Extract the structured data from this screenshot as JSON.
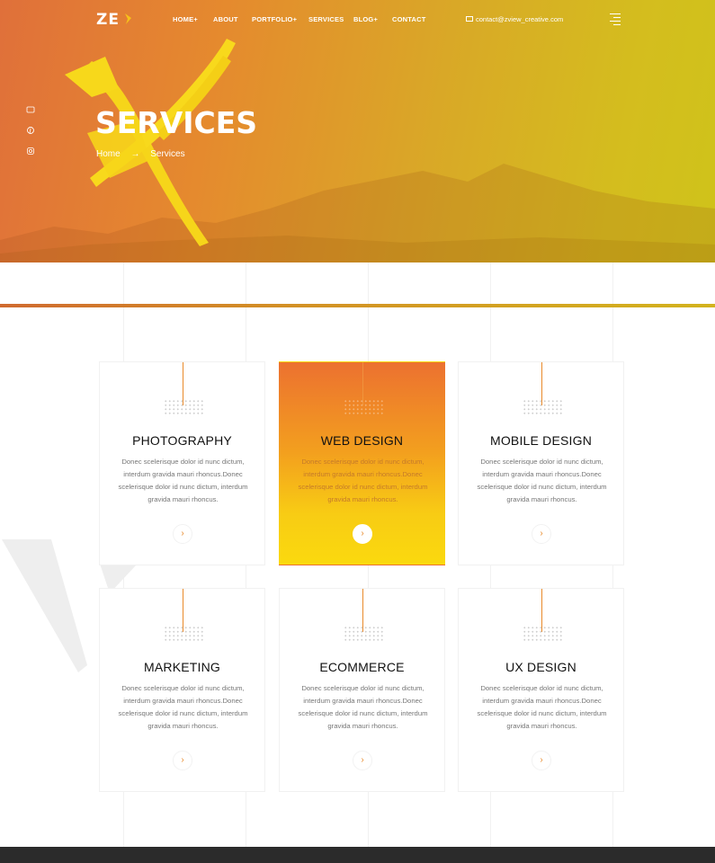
{
  "header": {
    "logo": "ZE",
    "nav": [
      {
        "label": "HOME",
        "plus": "+"
      },
      {
        "label": "ABOUT",
        "plus": ""
      },
      {
        "label": "PORTFOLIO",
        "plus": "+"
      },
      {
        "label": "SERVICES",
        "plus": ""
      },
      {
        "label": "BLOG",
        "plus": "+"
      },
      {
        "label": "CONTACT",
        "plus": ""
      }
    ],
    "email": "contact@zview_creative.com"
  },
  "hero": {
    "title": "SERVICES",
    "breadcrumb_home": "Home",
    "breadcrumb_arrow": "→",
    "breadcrumb_current": "Services"
  },
  "social_icons": [
    "facebook-icon",
    "pinterest-icon",
    "instagram-icon"
  ],
  "services": [
    {
      "title": "PHOTOGRAPHY",
      "desc": "Donec scelerisque dolor id nunc dictum, interdum gravida mauri rhoncus.Donec scelerisque dolor id nunc dictum, interdum gravida mauri rhoncus.",
      "button": "›",
      "active": false
    },
    {
      "title": "WEB DESIGN",
      "desc": "Donec scelerisque dolor id nunc dictum, interdum gravida mauri rhoncus.Donec scelerisque dolor id nunc dictum, interdum gravida mauri rhoncus.",
      "button": "›",
      "active": true
    },
    {
      "title": "MOBILE DESIGN",
      "desc": "Donec scelerisque dolor id nunc dictum, interdum gravida mauri rhoncus.Donec scelerisque dolor id nunc dictum, interdum gravida mauri rhoncus.",
      "button": "›",
      "active": false
    },
    {
      "title": "MARKETING",
      "desc": "Donec scelerisque dolor id nunc dictum, interdum gravida mauri rhoncus.Donec scelerisque dolor id nunc dictum, interdum gravida mauri rhoncus.",
      "button": "›",
      "active": false
    },
    {
      "title": "ECOMMERCE",
      "desc": "Donec scelerisque dolor id nunc dictum, interdum gravida mauri rhoncus.Donec scelerisque dolor id nunc dictum, interdum gravida mauri rhoncus.",
      "button": "›",
      "active": false
    },
    {
      "title": "UX DESIGN",
      "desc": "Donec scelerisque dolor id nunc dictum, interdum gravida mauri rhoncus.Donec scelerisque dolor id nunc dictum, interdum gravida mauri rhoncus.",
      "button": "›",
      "active": false
    }
  ],
  "colors": {
    "accent_orange": "#ec7130",
    "accent_yellow": "#fad90e",
    "hero_left": "#e0703a",
    "hero_right": "#cfc31a"
  }
}
